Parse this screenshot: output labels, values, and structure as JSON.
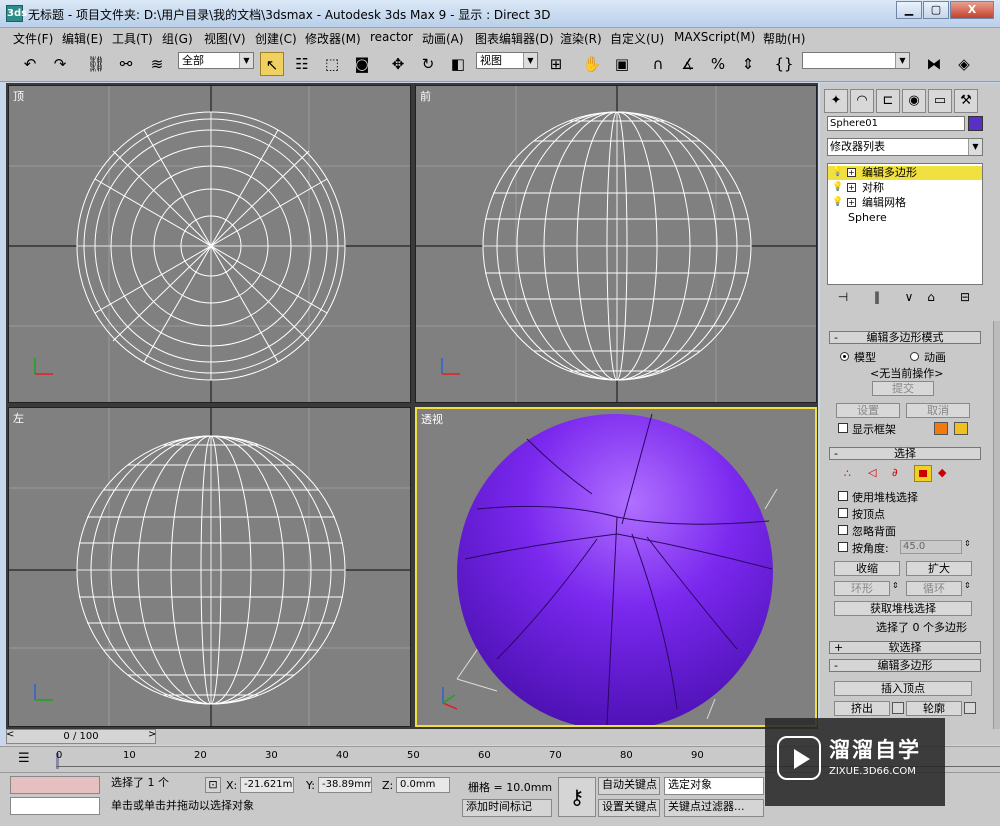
{
  "window": {
    "app_icon": "3ds",
    "title": "无标题     - 项目文件夹: D:\\用户目录\\我的文档\\3dsmax     - Autodesk 3ds Max 9     - 显示 : Direct 3D",
    "minimize": "▁",
    "maximize": "▢",
    "close": "X"
  },
  "menu": [
    "文件(F)",
    "编辑(E)",
    "工具(T)",
    "组(G)",
    "视图(V)",
    "创建(C)",
    "修改器(M)",
    "reactor",
    "动画(A)",
    "图表编辑器(D)",
    "渲染(R)",
    "自定义(U)",
    "MAXScript(M)",
    "帮助(H)"
  ],
  "toolbar": {
    "filter_value": "全部",
    "refcoord_value": "视图",
    "named_selection_value": ""
  },
  "viewports": {
    "top": "顶",
    "front": "前",
    "left": "左",
    "perspective": "透视"
  },
  "command_panel": {
    "object_name": "Sphere01",
    "object_color": "#5a2fc4",
    "modifier_list": "修改器列表",
    "stack": [
      {
        "label": "编辑多边形",
        "highlighted": true
      },
      {
        "label": "对称",
        "highlighted": false
      },
      {
        "label": "编辑网格",
        "highlighted": false
      }
    ],
    "stack_base": "Sphere"
  },
  "rollouts": {
    "mode_title": "编辑多边形模式",
    "model": "模型",
    "animate": "动画",
    "no_op": "<无当前操作>",
    "commit": "提交",
    "settings": "设置",
    "cancel": "取消",
    "show_cage": "显示框架",
    "select_title": "选择",
    "use_stack": "使用堆栈选择",
    "by_vertex": "按顶点",
    "ignore_backface": "忽略背面",
    "by_angle": "按角度:",
    "angle_value": "45.0",
    "shrink": "收缩",
    "grow": "扩大",
    "ring": "环形",
    "loop": "循环",
    "get_stack": "获取堆栈选择",
    "selected_info": "选择了 0 个多边形",
    "soft_title": "软选择",
    "edit_poly_title": "编辑多边形",
    "insert_vertex": "插入顶点",
    "extrude": "挤出",
    "outline": "轮廓"
  },
  "timeline": {
    "frame_display": "0 / 100",
    "ticks": [
      "0",
      "10",
      "20",
      "30",
      "40",
      "50",
      "60",
      "70",
      "80",
      "90"
    ]
  },
  "status": {
    "selected": "选择了 1 个",
    "x_label": "X:",
    "x_value": "-21.621mm",
    "y_label": "Y:",
    "y_value": "-38.89mm",
    "z_label": "Z:",
    "z_value": "0.0mm",
    "grid": "栅格 = 10.0mm",
    "prompt": "单击或单击并拖动以选择对象",
    "add_time_tag": "添加时间标记",
    "auto_key": "自动关键点",
    "set_key": "设置关键点",
    "selection_set": "选定对象",
    "key_filters": "关键点过滤器..."
  },
  "watermark": {
    "brand": "溜溜自学",
    "url": "ZIXUE.3D66.COM"
  }
}
